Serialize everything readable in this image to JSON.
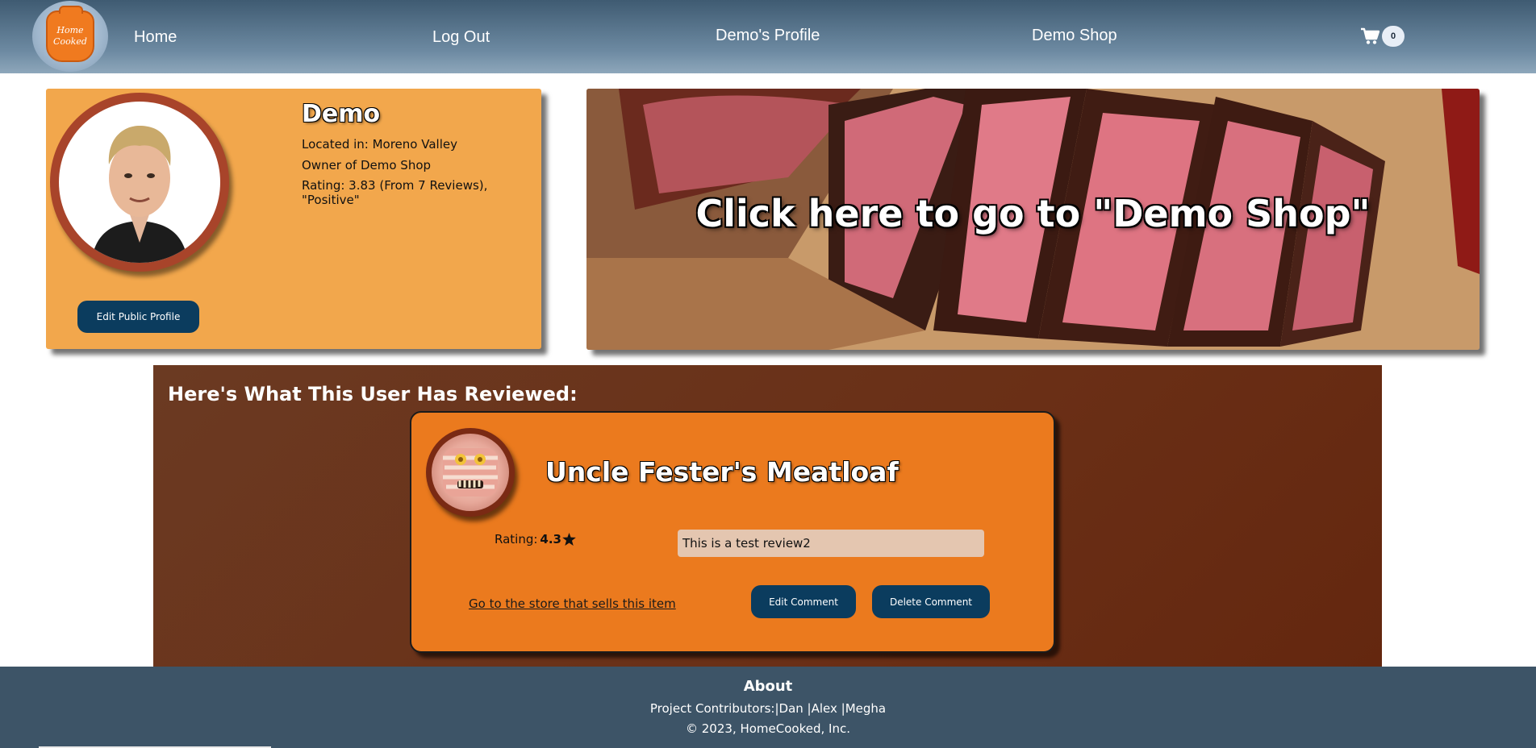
{
  "nav": {
    "logo_text_line1": "Home",
    "logo_text_line2": "Cooked",
    "links": [
      {
        "label": "Home"
      },
      {
        "label": "Log Out"
      },
      {
        "label": "Demo's Profile"
      },
      {
        "label": "Demo Shop"
      }
    ],
    "cart_count": "0",
    "cart_icon": "shopping-cart-icon"
  },
  "profile": {
    "name": "Demo",
    "location": "Located in: Moreno Valley",
    "owner": "Owner of Demo Shop",
    "rating": "Rating: 3.83 (From 7 Reviews), \"Positive\"",
    "edit_button": "Edit Public Profile"
  },
  "banner": {
    "text": "Click here to go to \"Demo Shop\""
  },
  "reviews": {
    "title": "Here's What This User Has Reviewed:",
    "items": [
      {
        "item_name": "Uncle Fester's Meatloaf",
        "rating_label": "Rating:",
        "rating_value": "4.3",
        "comment": "This is a test review2",
        "store_link": "Go to the store that sells this item",
        "edit_button": "Edit Comment",
        "delete_button": "Delete Comment"
      }
    ]
  },
  "footer": {
    "title": "About",
    "contributors": "Project Contributors:|Dan |Alex |Megha",
    "copyright": "© 2023, HomeCooked, Inc."
  },
  "colors": {
    "nav_bg": "#4c6a82",
    "profile_card_bg": "#f2a74c",
    "review_section_bg": "#6b3a22",
    "review_card_bg": "#eb7a1e",
    "button_bg": "#0b3c5e",
    "footer_bg": "#3d5467"
  }
}
